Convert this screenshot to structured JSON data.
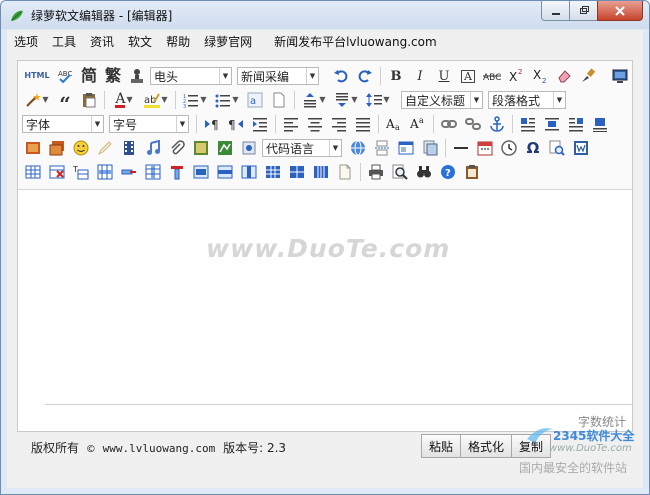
{
  "window": {
    "title": "绿萝软文编辑器 - [编辑器]"
  },
  "menu": [
    {
      "label": "选项"
    },
    {
      "label": "工具"
    },
    {
      "label": "资讯"
    },
    {
      "label": "软文"
    },
    {
      "label": "帮助"
    },
    {
      "label": "绿萝官网"
    },
    {
      "label": "新闻发布平台lvluowang.com"
    }
  ],
  "toolbar": {
    "html_label": "HTML",
    "simplified_label": "简",
    "traditional_label": "繁",
    "style_select": {
      "value": "电头"
    },
    "category_select": {
      "value": "新闻采编"
    },
    "bold_label": "B",
    "italic_label": "I",
    "underline_label": "U",
    "fontcolor_label": "A",
    "custom_heading_select": {
      "value": "自定义标题"
    },
    "paragraph_format_select": {
      "value": "段落格式"
    },
    "font_select": {
      "value": "字体"
    },
    "fontsize_select": {
      "value": "字号"
    },
    "code_lang_select": {
      "value": "代码语言"
    }
  },
  "editor": {
    "watermark": "www.DuoTe.com",
    "word_count_label": "字数统计"
  },
  "status": {
    "copyright": "版权所有",
    "site": "www.lvluowang.com",
    "version": "版本号: 2.3"
  },
  "actions": {
    "paste": "粘贴",
    "format": "格式化",
    "copy": "复制"
  },
  "watermark_logo": {
    "brand": "2345软件大全",
    "url": "www.DuoTe.com",
    "slogan": "国内最安全的软件站"
  },
  "colors": {
    "accent": "#3f6fb5",
    "title_bar": "#d6e2f2",
    "close_button": "#c7432c"
  }
}
